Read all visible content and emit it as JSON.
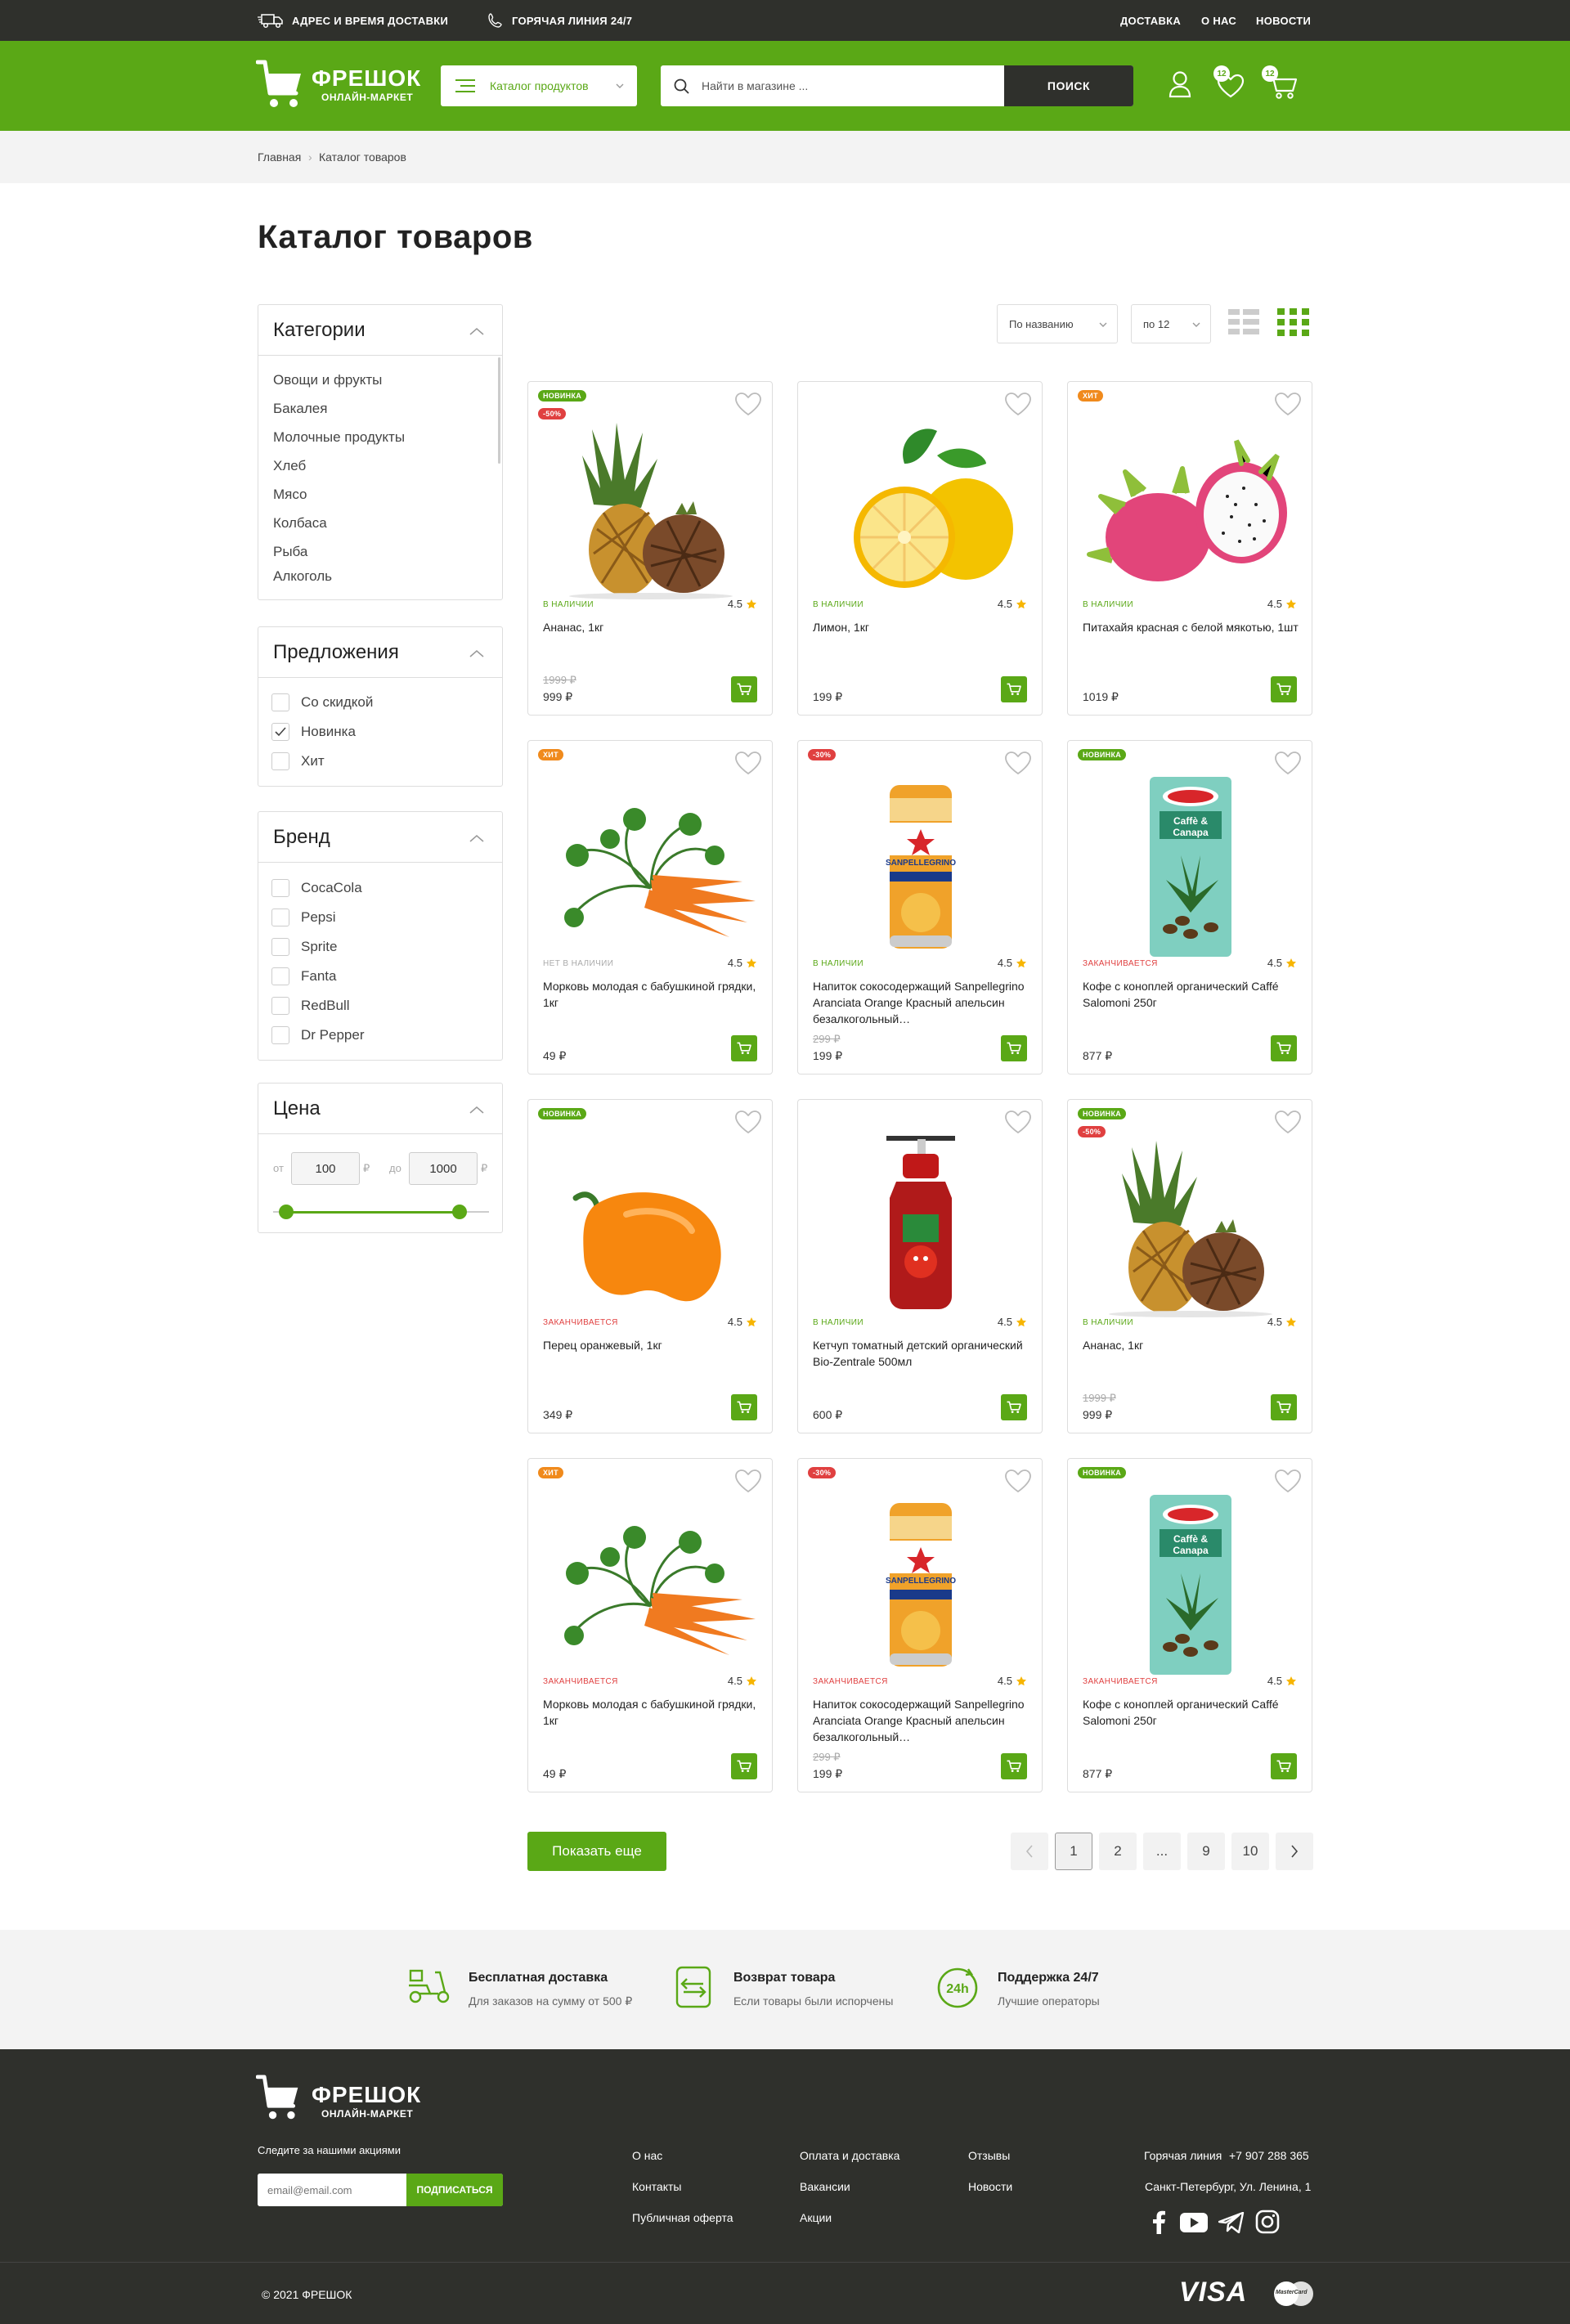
{
  "topbar": {
    "delivery": "АДРЕС И ВРЕМЯ ДОСТАВКИ",
    "hotline": "ГОРЯЧАЯ ЛИНИЯ 24/7",
    "links": [
      "ДОСТАВКА",
      "О НАС",
      "НОВОСТИ"
    ]
  },
  "brand": {
    "name": "ФРЕШОК",
    "tagline": "ОНЛАЙН-МАРКЕТ"
  },
  "header": {
    "catalog_btn": "Каталог продуктов",
    "search_placeholder": "Найти в магазине ...",
    "search_btn": "ПОИСК",
    "wishlist_count": "12",
    "cart_count": "12"
  },
  "breadcrumb": [
    "Главная",
    "Каталог товаров"
  ],
  "page_title": "Каталог товаров",
  "filters": {
    "categories": {
      "title": "Категории",
      "items": [
        "Овощи и фрукты",
        "Бакалея",
        "Молочные продукты",
        "Хлеб",
        "Мясо",
        "Колбаса",
        "Рыба",
        "Алкоголь"
      ]
    },
    "offers": {
      "title": "Предложения",
      "items": [
        {
          "label": "Со скидкой",
          "checked": false
        },
        {
          "label": "Новинка",
          "checked": true
        },
        {
          "label": "Хит",
          "checked": false
        }
      ]
    },
    "brand": {
      "title": "Бренд",
      "items": [
        "CocaCola",
        "Pepsi",
        "Sprite",
        "Fanta",
        "RedBull",
        "Dr Pepper"
      ]
    },
    "price": {
      "title": "Цена",
      "from_label": "от",
      "to_label": "до",
      "from": "100",
      "to": "1000",
      "currency": "₽"
    }
  },
  "toolbar": {
    "sort": "По названию",
    "per_page": "по 12"
  },
  "products": [
    {
      "labels": [
        "НОВИНКА",
        "-50%"
      ],
      "stock": "В НАЛИЧИИ",
      "rating": "4.5",
      "name": "Ананас, 1кг",
      "old_price": "1999 ₽",
      "price": "999 ₽",
      "image": "pineapple"
    },
    {
      "labels": [],
      "stock": "В НАЛИЧИИ",
      "rating": "4.5",
      "name": "Лимон, 1кг",
      "old_price": "",
      "price": "199 ₽",
      "image": "lemon"
    },
    {
      "labels": [
        "ХИТ"
      ],
      "stock": "В НАЛИЧИИ",
      "rating": "4.5",
      "name": "Питахайя красная с белой мякотью, 1шт",
      "old_price": "",
      "price": "1019 ₽",
      "image": "pitahaya"
    },
    {
      "labels": [
        "ХИТ"
      ],
      "stock": "НЕТ В НАЛИЧИИ",
      "rating": "4.5",
      "name": "Морковь молодая с бабушкиной грядки, 1кг",
      "old_price": "",
      "price": "49 ₽",
      "image": "carrot"
    },
    {
      "labels": [
        "-30%"
      ],
      "stock": "В НАЛИЧИИ",
      "rating": "4.5",
      "name": "Напиток сокосодержащий Sanpellegrino Aranciata Orange Красный апельсин безалкогольный…",
      "old_price": "299 ₽",
      "price": "199 ₽",
      "image": "can"
    },
    {
      "labels": [
        "НОВИНКА"
      ],
      "stock": "ЗАКАНЧИВАЕТСЯ",
      "rating": "4.5",
      "name": "Кофе с коноплей органический Caffé Salomoni 250г",
      "old_price": "",
      "price": "877 ₽",
      "image": "coffee"
    },
    {
      "labels": [
        "НОВИНКА"
      ],
      "stock": "ЗАКАНЧИВАЕТСЯ",
      "rating": "4.5",
      "name": "Перец оранжевый, 1кг",
      "old_price": "",
      "price": "349 ₽",
      "image": "pepper"
    },
    {
      "labels": [],
      "stock": "В НАЛИЧИИ",
      "rating": "4.5",
      "name": "Кетчуп томатный детский органический Bio-Zentrale 500мл",
      "old_price": "",
      "price": "600 ₽",
      "image": "ketchup"
    },
    {
      "labels": [
        "НОВИНКА",
        "-50%"
      ],
      "stock": "В НАЛИЧИИ",
      "rating": "4.5",
      "name": "Ананас, 1кг",
      "old_price": "1999 ₽",
      "price": "999 ₽",
      "image": "pineapple"
    },
    {
      "labels": [
        "ХИТ"
      ],
      "stock": "ЗАКАНЧИВАЕТСЯ",
      "rating": "4.5",
      "name": "Морковь молодая с бабушкиной грядки, 1кг",
      "old_price": "",
      "price": "49 ₽",
      "image": "carrot"
    },
    {
      "labels": [
        "-30%"
      ],
      "stock": "ЗАКАНЧИВАЕТСЯ",
      "rating": "4.5",
      "name": "Напиток сокосодержащий Sanpellegrino Aranciata Orange Красный апельсин безалкогольный…",
      "old_price": "299 ₽",
      "price": "199 ₽",
      "image": "can"
    },
    {
      "labels": [
        "НОВИНКА"
      ],
      "stock": "ЗАКАНЧИВАЕТСЯ",
      "rating": "4.5",
      "name": "Кофе с коноплей органический Caffé Salomoni 250г",
      "old_price": "",
      "price": "877 ₽",
      "image": "coffee"
    }
  ],
  "pagination": {
    "more_btn": "Показать еще",
    "pages": [
      "1",
      "2",
      "...",
      "9",
      "10"
    ],
    "current": "1"
  },
  "features": [
    {
      "title": "Бесплатная доставка",
      "text": "Для заказов на сумму от 500 ₽",
      "icon": "scooter-icon"
    },
    {
      "title": "Возврат товара",
      "text": "Если товары были испорчены",
      "icon": "return-icon"
    },
    {
      "title": "Поддержка 24/7",
      "text": "Лучшие операторы",
      "icon": "support-24h-icon"
    }
  ],
  "footer": {
    "subscribe_label": "Следите за нашими акциями",
    "email_placeholder": "email@email.com",
    "subscribe_btn": "ПОДПИСАТЬСЯ",
    "col1": [
      "О нас",
      "Контакты",
      "Публичная оферта"
    ],
    "col2": [
      "Оплата и доставка",
      "Вакансии",
      "Акции"
    ],
    "col3": [
      "Отзывы",
      "Новости"
    ],
    "hotline_label": "Горячая линия",
    "phone": "+7 907 288 365",
    "address": "Санкт-Петербург, Ул. Ленина, 1",
    "copyright": "© 2021 ФРЕШОК",
    "visa": "VISA",
    "mastercard": "MasterCard"
  },
  "colors": {
    "accent": "#5aa816",
    "dark": "#2f302c",
    "new_label": "#5aa816",
    "sale_label": "#e04040",
    "hit_label": "#f08a1c",
    "out_of_stock": "#aaaaaa",
    "ending": "#e04040",
    "in_stock": "#5aa816"
  }
}
